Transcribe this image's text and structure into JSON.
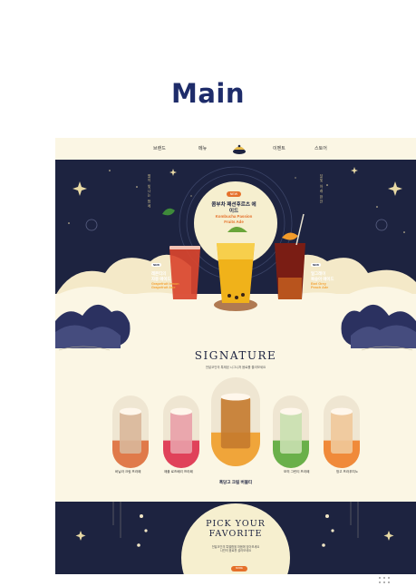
{
  "page": {
    "title": "Main"
  },
  "nav": {
    "items": [
      "브랜드",
      "메뉴",
      "",
      "이벤트",
      "스토어"
    ]
  },
  "hero": {
    "center": {
      "badge": "NEW",
      "name_ko": "콤부차 패션후르츠 에이드",
      "name_en": "Kombucha Passion Fruits Ade"
    },
    "left": {
      "badge": "NEW",
      "name_ko_1": "레몬티의",
      "name_ko_2": "자몽 에이드",
      "name_en_1": "Grapefruit lemon",
      "name_en_2": "Grapefruit Ade"
    },
    "right": {
      "badge": "NEW",
      "name_ko_1": "얼그레이",
      "name_ko_2": "복숭아 에이드",
      "name_en_1": "Earl Grey",
      "name_en_2": "Peach Ade"
    },
    "vertical_left": "별이 빛나는 밤에",
    "vertical_right": "달빛 아래 한잔"
  },
  "signature": {
    "title": "SIGNATURE",
    "subtitle": "전달코인의 특제된 시그니처 음료를 즐겨보세요",
    "products": [
      {
        "label": "바닐라 크림 프라페",
        "colors": {
          "top": "#d9b79a",
          "bottom": "#e07a4a"
        }
      },
      {
        "label": "애플 로즈베리 프라페",
        "colors": {
          "top": "#e9a0a8",
          "bottom": "#e0425a"
        }
      },
      {
        "label": "",
        "colors": {
          "top": "#c47a2e",
          "bottom": "#f0a53a"
        }
      },
      {
        "label": "모히 그린티 프라페",
        "colors": {
          "top": "#c9e0b0",
          "bottom": "#6ab04a"
        }
      },
      {
        "label": "망고 프라푸치노",
        "colors": {
          "top": "#f0c89a",
          "bottom": "#f08a3a"
        }
      }
    ],
    "featured_label": "흑당고 크림 버블티"
  },
  "pick": {
    "title_1": "PICK YOUR",
    "title_2": "FAVORITE",
    "sub_1": "전달코인의 특별함을 마음에 담아보세요",
    "sub_2": "나만의 음료를 골라보세요",
    "button": "MORE"
  },
  "colors": {
    "navy": "#1d2340",
    "cream": "#fbf6e4",
    "orange": "#e5702a",
    "title": "#1e2c6a"
  }
}
